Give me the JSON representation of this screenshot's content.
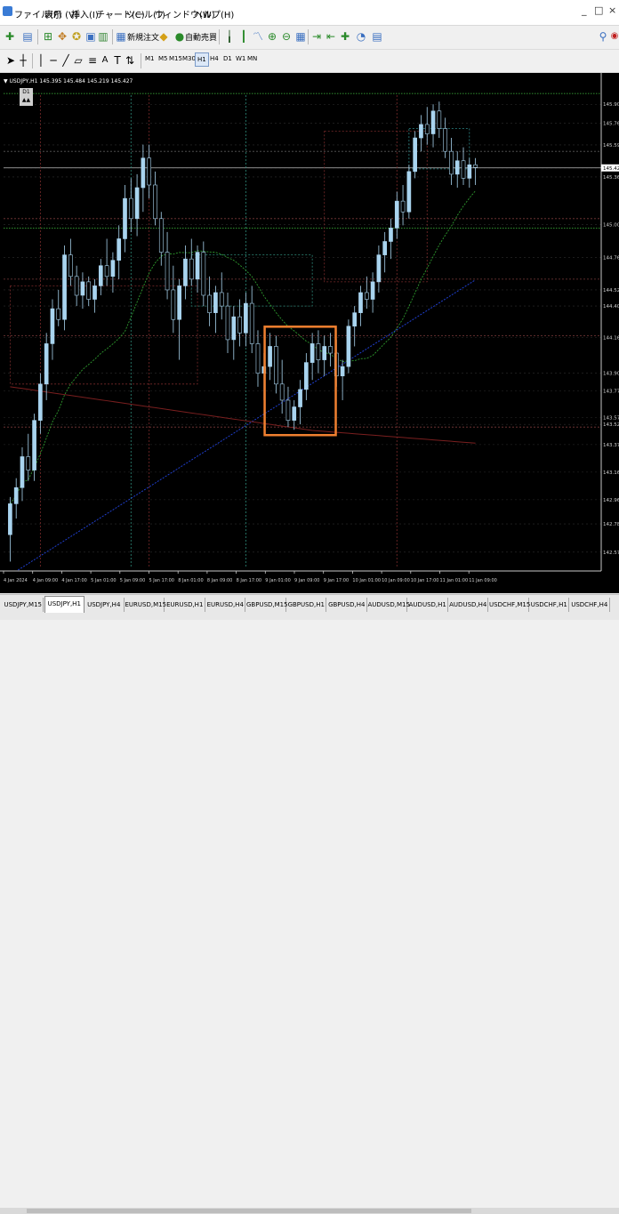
{
  "menu": {
    "items": [
      "ファイル(F)",
      "表示 (V)",
      "挿入(I)",
      "チャート(C)",
      "ツール(T)",
      "ウィンドウ(W)",
      "ヘルプ(H)"
    ],
    "window_controls": [
      "_",
      "□",
      "×"
    ]
  },
  "toolbar": {
    "new_order_label": "新規注文",
    "auto_trading_label": "自動売買",
    "timeframes": [
      "M1",
      "M5",
      "M15",
      "M30",
      "H1",
      "H4",
      "D1",
      "W1",
      "MN"
    ],
    "active_timeframe": "H1",
    "right_icons": [
      "search-icon",
      "expand-icon"
    ]
  },
  "chart": {
    "title": "▼ USDJPY,H1 145.395 145.484 145.219 145.427",
    "period_badge": "D1",
    "current_price": "145.427",
    "price_labels": [
      "145.900",
      "145.760",
      "145.598",
      "145.427",
      "145.360",
      "145.005",
      "144.760",
      "144.520",
      "144.400",
      "144.165",
      "143.900",
      "143.770",
      "143.570",
      "143.520",
      "143.370",
      "143.165",
      "142.960",
      "142.780",
      "142.570"
    ],
    "time_labels": [
      "4 Jan 2024",
      "4 Jan 09:00",
      "4 Jan 17:00",
      "5 Jan 01:00",
      "5 Jan 09:00",
      "5 Jan 17:00",
      "8 Jan 01:00",
      "8 Jan 09:00",
      "8 Jan 17:00",
      "9 Jan 01:00",
      "9 Jan 09:00",
      "9 Jan 17:00",
      "10 Jan 01:00",
      "10 Jan 09:00",
      "10 Jan 17:00",
      "11 Jan 01:00",
      "11 Jan 09:00"
    ],
    "colors": {
      "background": "#000000",
      "bull_candle": "#a9d4ef",
      "bear_candle": "#000000",
      "candle_outline": "#a9d4ef",
      "highlight_box": "#f08030",
      "ma_green": "#2e9a2e",
      "ma_blue": "#1f3fcf",
      "ma_red": "#7a1f1f",
      "support_green": "#3fbf3f"
    }
  },
  "chart_data": {
    "type": "candlestick",
    "symbol": "USDJPY",
    "timeframe": "H1",
    "ylim": [
      142.45,
      146.1
    ],
    "current_price": 145.427,
    "candles": [
      [
        142.7,
        142.98,
        142.5,
        142.93
      ],
      [
        142.93,
        143.12,
        142.82,
        143.05
      ],
      [
        143.05,
        143.35,
        142.95,
        143.28
      ],
      [
        143.28,
        143.45,
        143.1,
        143.18
      ],
      [
        143.18,
        143.6,
        143.1,
        143.55
      ],
      [
        143.55,
        143.9,
        143.45,
        143.82
      ],
      [
        143.82,
        144.2,
        143.7,
        144.12
      ],
      [
        144.12,
        144.45,
        144.0,
        144.38
      ],
      [
        144.38,
        144.52,
        144.25,
        144.3
      ],
      [
        144.3,
        144.85,
        144.22,
        144.78
      ],
      [
        144.78,
        144.9,
        144.55,
        144.62
      ],
      [
        144.62,
        144.7,
        144.4,
        144.48
      ],
      [
        144.48,
        144.65,
        144.38,
        144.58
      ],
      [
        144.58,
        144.62,
        144.4,
        144.45
      ],
      [
        144.45,
        144.6,
        144.35,
        144.55
      ],
      [
        144.55,
        144.75,
        144.48,
        144.7
      ],
      [
        144.7,
        144.9,
        144.55,
        144.62
      ],
      [
        144.62,
        144.8,
        144.5,
        144.74
      ],
      [
        144.74,
        145.0,
        144.6,
        144.9
      ],
      [
        144.9,
        145.3,
        144.8,
        145.2
      ],
      [
        145.2,
        145.35,
        144.95,
        145.05
      ],
      [
        145.05,
        145.38,
        144.92,
        145.28
      ],
      [
        145.28,
        145.6,
        145.1,
        145.5
      ],
      [
        145.5,
        145.6,
        145.2,
        145.3
      ],
      [
        145.3,
        145.4,
        145.0,
        145.05
      ],
      [
        145.05,
        145.1,
        144.7,
        144.8
      ],
      [
        144.8,
        144.95,
        144.45,
        144.52
      ],
      [
        144.52,
        144.7,
        144.2,
        144.3
      ],
      [
        144.3,
        144.6,
        144.0,
        144.55
      ],
      [
        144.55,
        144.85,
        144.45,
        144.75
      ],
      [
        144.75,
        144.9,
        144.55,
        144.6
      ],
      [
        144.6,
        144.85,
        144.5,
        144.8
      ],
      [
        144.8,
        144.88,
        144.4,
        144.48
      ],
      [
        144.48,
        144.62,
        144.25,
        144.35
      ],
      [
        144.35,
        144.55,
        144.2,
        144.5
      ],
      [
        144.5,
        144.65,
        144.3,
        144.4
      ],
      [
        144.4,
        144.5,
        144.05,
        144.15
      ],
      [
        144.15,
        144.4,
        144.0,
        144.32
      ],
      [
        144.32,
        144.45,
        144.1,
        144.2
      ],
      [
        144.2,
        144.5,
        144.1,
        144.42
      ],
      [
        144.42,
        144.55,
        144.05,
        144.12
      ],
      [
        144.12,
        144.22,
        143.8,
        143.9
      ],
      [
        143.9,
        144.05,
        143.7,
        143.95
      ],
      [
        143.95,
        144.2,
        143.85,
        144.1
      ],
      [
        144.1,
        144.18,
        143.75,
        143.82
      ],
      [
        143.82,
        144.0,
        143.6,
        143.7
      ],
      [
        143.7,
        143.8,
        143.5,
        143.55
      ],
      [
        143.55,
        143.7,
        143.48,
        143.65
      ],
      [
        143.65,
        143.85,
        143.52,
        143.78
      ],
      [
        143.78,
        144.05,
        143.7,
        143.98
      ],
      [
        143.98,
        144.2,
        143.85,
        144.12
      ],
      [
        144.12,
        144.22,
        143.9,
        144.0
      ],
      [
        144.0,
        144.18,
        143.88,
        144.1
      ],
      [
        144.1,
        144.2,
        143.95,
        144.05
      ],
      [
        144.05,
        144.15,
        143.8,
        143.88
      ],
      [
        143.88,
        144.0,
        143.7,
        143.95
      ],
      [
        143.95,
        144.3,
        143.9,
        144.25
      ],
      [
        144.25,
        144.4,
        144.1,
        144.35
      ],
      [
        144.35,
        144.55,
        144.25,
        144.5
      ],
      [
        144.5,
        144.62,
        144.38,
        144.45
      ],
      [
        144.45,
        144.65,
        144.35,
        144.58
      ],
      [
        144.58,
        144.85,
        144.5,
        144.78
      ],
      [
        144.78,
        144.95,
        144.65,
        144.88
      ],
      [
        144.88,
        145.05,
        144.75,
        144.98
      ],
      [
        144.98,
        145.25,
        144.9,
        145.18
      ],
      [
        145.18,
        145.3,
        145.0,
        145.1
      ],
      [
        145.1,
        145.45,
        145.05,
        145.4
      ],
      [
        145.4,
        145.7,
        145.35,
        145.65
      ],
      [
        145.65,
        145.82,
        145.55,
        145.75
      ],
      [
        145.75,
        145.88,
        145.6,
        145.68
      ],
      [
        145.68,
        145.9,
        145.58,
        145.85
      ],
      [
        145.85,
        145.92,
        145.65,
        145.72
      ],
      [
        145.72,
        145.8,
        145.5,
        145.55
      ],
      [
        145.55,
        145.65,
        145.3,
        145.38
      ],
      [
        145.38,
        145.55,
        145.28,
        145.48
      ],
      [
        145.48,
        145.58,
        145.3,
        145.35
      ],
      [
        145.35,
        145.5,
        145.28,
        145.45
      ],
      [
        145.45,
        145.5,
        145.3,
        145.43
      ]
    ],
    "highlight_range": [
      43,
      53
    ]
  },
  "tabs": {
    "items": [
      "USDJPY,M15",
      "USDJPY,H1",
      "USDJPY,H4",
      "EURUSD,M15",
      "EURUSD,H1",
      "EURUSD,H4",
      "GBPUSD,M15",
      "GBPUSD,H1",
      "GBPUSD,H4",
      "AUDUSD,M15",
      "AUDUSD,H1",
      "AUDUSD,H4",
      "USDCHF,M15",
      "USDCHF,H1",
      "USDCHF,H4"
    ],
    "active": "USDJPY,H1"
  }
}
